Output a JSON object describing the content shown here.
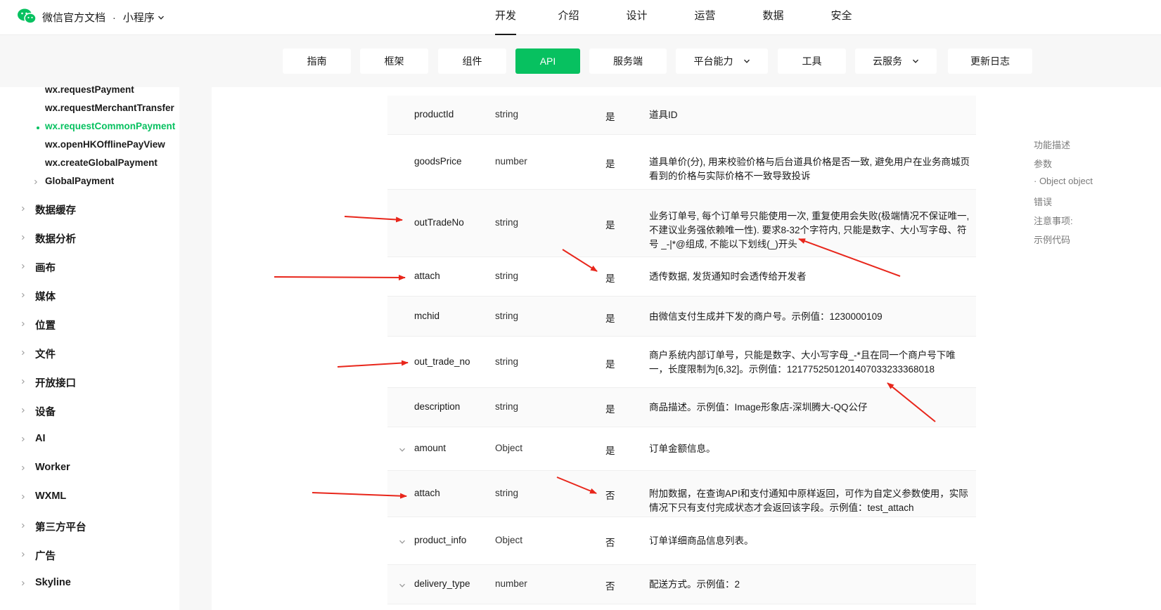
{
  "header": {
    "site_title": "微信官方文档",
    "separator": "·",
    "product": "小程序",
    "nav": [
      "开发",
      "介绍",
      "设计",
      "运营",
      "数据",
      "安全"
    ],
    "nav_active_index": 0
  },
  "subnav": {
    "tabs": [
      {
        "label": "指南",
        "dropdown": false
      },
      {
        "label": "框架",
        "dropdown": false
      },
      {
        "label": "组件",
        "dropdown": false
      },
      {
        "label": "API",
        "dropdown": false
      },
      {
        "label": "服务端",
        "dropdown": false
      },
      {
        "label": "平台能力",
        "dropdown": true
      },
      {
        "label": "工具",
        "dropdown": false
      },
      {
        "label": "云服务",
        "dropdown": true
      },
      {
        "label": "更新日志",
        "dropdown": false
      }
    ],
    "active_index": 3
  },
  "sidebar": {
    "sub_items": [
      {
        "label": "wx.requestPayment",
        "active": false
      },
      {
        "label": "wx.requestMerchantTransfer",
        "active": false
      },
      {
        "label": "wx.requestCommonPayment",
        "active": true
      },
      {
        "label": "wx.openHKOfflinePayView",
        "active": false
      },
      {
        "label": "wx.createGlobalPayment",
        "active": false
      },
      {
        "label": "GlobalPayment",
        "active": false
      }
    ],
    "categories": [
      "数据缓存",
      "数据分析",
      "画布",
      "媒体",
      "位置",
      "文件",
      "开放接口",
      "设备",
      "AI",
      "Worker",
      "WXML",
      "第三方平台",
      "广告",
      "Skyline"
    ]
  },
  "params_table": {
    "rows": [
      {
        "name": "productId",
        "type": "string",
        "required": "是",
        "desc": "道具ID"
      },
      {
        "name": "goodsPrice",
        "type": "number",
        "required": "是",
        "desc": "道具单价(分), 用来校验价格与后台道具价格是否一致, 避免用户在业务商城页看到的价格与实际价格不一致导致投诉"
      },
      {
        "name": "outTradeNo",
        "type": "string",
        "required": "是",
        "desc": "业务订单号, 每个订单号只能使用一次, 重复使用会失败(极端情况不保证唯一, 不建议业务强依赖唯一性). 要求8-32个字符内, 只能是数字、大小写字母、符号 _-|*@组成, 不能以下划线(_)开头"
      },
      {
        "name": "attach",
        "type": "string",
        "required": "是",
        "desc": "透传数据, 发货通知时会透传给开发者"
      },
      {
        "name": "mchid",
        "type": "string",
        "required": "是",
        "desc": "由微信支付生成并下发的商户号。示例值：1230000109"
      },
      {
        "name": "out_trade_no",
        "type": "string",
        "required": "是",
        "desc": "商户系统内部订单号，只能是数字、大小写字母_-*且在同一个商户号下唯一，长度限制为[6,32]。示例值：1217752501201407033233368018"
      },
      {
        "name": "description",
        "type": "string",
        "required": "是",
        "desc": "商品描述。示例值：Image形象店-深圳腾大-QQ公仔"
      },
      {
        "name": "amount",
        "type": "Object",
        "required": "是",
        "desc": "订单金额信息。",
        "expandable": true
      },
      {
        "name": "attach",
        "type": "string",
        "required": "否",
        "desc": "附加数据，在查询API和支付通知中原样返回，可作为自定义参数使用，实际情况下只有支付完成状态才会返回该字段。示例值：test_attach"
      },
      {
        "name": "product_info",
        "type": "Object",
        "required": "否",
        "desc": "订单详细商品信息列表。",
        "expandable": true
      },
      {
        "name": "delivery_type",
        "type": "number",
        "required": "否",
        "desc": "配送方式。示例值：2",
        "expandable": true
      }
    ]
  },
  "toc": {
    "items": [
      "功能描述",
      "参数",
      "· Object object",
      "错误",
      "注意事项:",
      "示例代码"
    ]
  },
  "colors": {
    "accent": "#07c160",
    "annotation_arrow": "#e8261b",
    "subnav_bg": "#f7f7f7",
    "row_alt_bg": "#fafafa"
  }
}
